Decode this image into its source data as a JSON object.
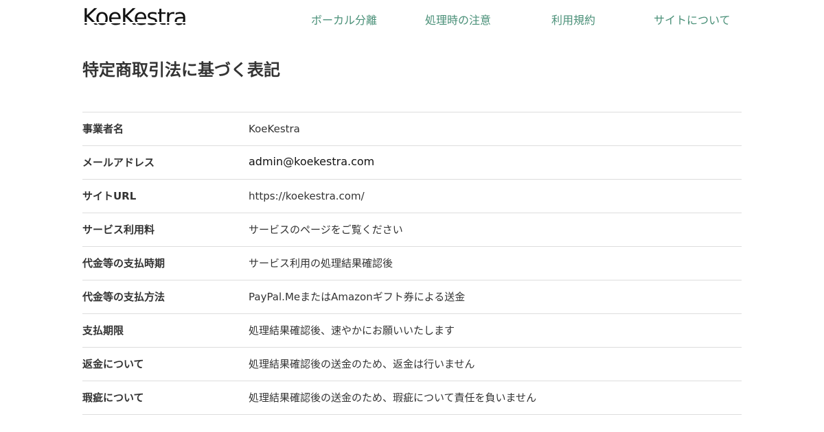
{
  "header": {
    "logo_text": "KoeKestra",
    "nav": [
      "ボーカル分離",
      "処理時の注意",
      "利用規約",
      "サイトについて"
    ],
    "link_color": "#4a9078"
  },
  "page": {
    "title": "特定商取引法に基づく表記"
  },
  "table": {
    "rows": [
      {
        "label": "事業者名",
        "value": "KoeKestra"
      },
      {
        "label": "メールアドレス",
        "value": "admin@koekestra.com"
      },
      {
        "label": "サイトURL",
        "value": "https://koekestra.com/"
      },
      {
        "label": "サービス利用料",
        "value": "サービスのページをご覧ください"
      },
      {
        "label": "代金等の支払時期",
        "value": "サービス利用の処理結果確認後"
      },
      {
        "label": "代金等の支払方法",
        "value": "PayPal.MeまたはAmazonギフト券による送金"
      },
      {
        "label": "支払期限",
        "value": "処理結果確認後、速やかにお願いいたします"
      },
      {
        "label": "返金について",
        "value": "処理結果確認後の送金のため、返金は行いません"
      },
      {
        "label": "瑕疵について",
        "value": "処理結果確認後の送金のため、瑕疵について責任を負いません"
      }
    ]
  }
}
